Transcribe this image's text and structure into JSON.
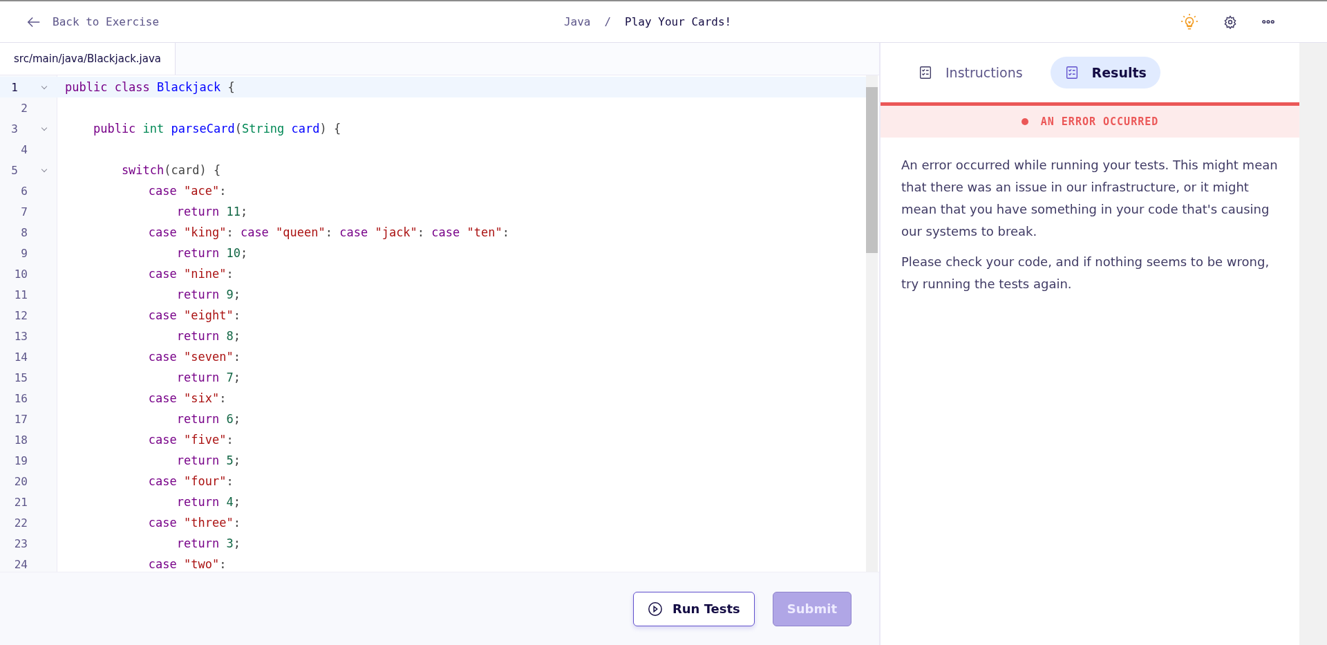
{
  "header": {
    "back_link": "Back to Exercise",
    "breadcrumb": {
      "track": "Java",
      "separator": "/",
      "exercise": "Play Your Cards!"
    }
  },
  "editor": {
    "tabs": [
      {
        "label": "src/main/java/Blackjack.java",
        "selected": true
      }
    ],
    "lines": [
      {
        "number": "1",
        "foldable": true,
        "active": true,
        "tokens": [
          {
            "kind": "keyword",
            "text": "public class "
          },
          {
            "kind": "def",
            "text": "Blackjack"
          },
          {
            "kind": "plain",
            "text": " {"
          }
        ]
      },
      {
        "number": "2",
        "foldable": false,
        "active": false
      },
      {
        "number": "3",
        "foldable": true,
        "active": false,
        "tokens": [
          {
            "kind": "keyword",
            "text": "    public "
          },
          {
            "kind": "type",
            "text": "int "
          },
          {
            "kind": "def",
            "text": "parseCard"
          },
          {
            "kind": "plain",
            "text": "("
          },
          {
            "kind": "type",
            "text": "String "
          },
          {
            "kind": "def",
            "text": "card"
          },
          {
            "kind": "plain",
            "text": ") {"
          }
        ]
      },
      {
        "number": "4",
        "foldable": false,
        "active": false
      },
      {
        "number": "5",
        "foldable": true,
        "active": false,
        "tokens": [
          {
            "kind": "keyword",
            "text": "        switch"
          },
          {
            "kind": "plain",
            "text": "(card) {"
          }
        ]
      },
      {
        "number": "6",
        "foldable": false,
        "active": false,
        "tokens": [
          {
            "kind": "keyword",
            "text": "            case "
          },
          {
            "kind": "string",
            "text": "\"ace\""
          },
          {
            "kind": "plain",
            "text": ":"
          }
        ]
      },
      {
        "number": "7",
        "foldable": false,
        "active": false,
        "tokens": [
          {
            "kind": "keyword",
            "text": "                return "
          },
          {
            "kind": "number",
            "text": "11"
          },
          {
            "kind": "plain",
            "text": ";"
          }
        ]
      },
      {
        "number": "8",
        "foldable": false,
        "active": false,
        "tokens": [
          {
            "kind": "keyword",
            "text": "            case "
          },
          {
            "kind": "string",
            "text": "\"king\""
          },
          {
            "kind": "plain",
            "text": ": "
          },
          {
            "kind": "keyword",
            "text": "case "
          },
          {
            "kind": "string",
            "text": "\"queen\""
          },
          {
            "kind": "plain",
            "text": ": "
          },
          {
            "kind": "keyword",
            "text": "case "
          },
          {
            "kind": "string",
            "text": "\"jack\""
          },
          {
            "kind": "plain",
            "text": ": "
          },
          {
            "kind": "keyword",
            "text": "case "
          },
          {
            "kind": "string",
            "text": "\"ten\""
          },
          {
            "kind": "plain",
            "text": ":"
          }
        ]
      },
      {
        "number": "9",
        "foldable": false,
        "active": false,
        "tokens": [
          {
            "kind": "keyword",
            "text": "                return "
          },
          {
            "kind": "number",
            "text": "10"
          },
          {
            "kind": "plain",
            "text": ";"
          }
        ]
      },
      {
        "number": "10",
        "foldable": false,
        "active": false,
        "tokens": [
          {
            "kind": "keyword",
            "text": "            case "
          },
          {
            "kind": "string",
            "text": "\"nine\""
          },
          {
            "kind": "plain",
            "text": ":"
          }
        ]
      },
      {
        "number": "11",
        "foldable": false,
        "active": false,
        "tokens": [
          {
            "kind": "keyword",
            "text": "                return "
          },
          {
            "kind": "number",
            "text": "9"
          },
          {
            "kind": "plain",
            "text": ";"
          }
        ]
      },
      {
        "number": "12",
        "foldable": false,
        "active": false,
        "tokens": [
          {
            "kind": "keyword",
            "text": "            case "
          },
          {
            "kind": "string",
            "text": "\"eight\""
          },
          {
            "kind": "plain",
            "text": ":"
          }
        ]
      },
      {
        "number": "13",
        "foldable": false,
        "active": false,
        "tokens": [
          {
            "kind": "keyword",
            "text": "                return "
          },
          {
            "kind": "number",
            "text": "8"
          },
          {
            "kind": "plain",
            "text": ";"
          }
        ]
      },
      {
        "number": "14",
        "foldable": false,
        "active": false,
        "tokens": [
          {
            "kind": "keyword",
            "text": "            case "
          },
          {
            "kind": "string",
            "text": "\"seven\""
          },
          {
            "kind": "plain",
            "text": ":"
          }
        ]
      },
      {
        "number": "15",
        "foldable": false,
        "active": false,
        "tokens": [
          {
            "kind": "keyword",
            "text": "                return "
          },
          {
            "kind": "number",
            "text": "7"
          },
          {
            "kind": "plain",
            "text": ";"
          }
        ]
      },
      {
        "number": "16",
        "foldable": false,
        "active": false,
        "tokens": [
          {
            "kind": "keyword",
            "text": "            case "
          },
          {
            "kind": "string",
            "text": "\"six\""
          },
          {
            "kind": "plain",
            "text": ":"
          }
        ]
      },
      {
        "number": "17",
        "foldable": false,
        "active": false,
        "tokens": [
          {
            "kind": "keyword",
            "text": "                return "
          },
          {
            "kind": "number",
            "text": "6"
          },
          {
            "kind": "plain",
            "text": ";"
          }
        ]
      },
      {
        "number": "18",
        "foldable": false,
        "active": false,
        "tokens": [
          {
            "kind": "keyword",
            "text": "            case "
          },
          {
            "kind": "string",
            "text": "\"five\""
          },
          {
            "kind": "plain",
            "text": ":"
          }
        ]
      },
      {
        "number": "19",
        "foldable": false,
        "active": false,
        "tokens": [
          {
            "kind": "keyword",
            "text": "                return "
          },
          {
            "kind": "number",
            "text": "5"
          },
          {
            "kind": "plain",
            "text": ";"
          }
        ]
      },
      {
        "number": "20",
        "foldable": false,
        "active": false,
        "tokens": [
          {
            "kind": "keyword",
            "text": "            case "
          },
          {
            "kind": "string",
            "text": "\"four\""
          },
          {
            "kind": "plain",
            "text": ":"
          }
        ]
      },
      {
        "number": "21",
        "foldable": false,
        "active": false,
        "tokens": [
          {
            "kind": "keyword",
            "text": "                return "
          },
          {
            "kind": "number",
            "text": "4"
          },
          {
            "kind": "plain",
            "text": ";"
          }
        ]
      },
      {
        "number": "22",
        "foldable": false,
        "active": false,
        "tokens": [
          {
            "kind": "keyword",
            "text": "            case "
          },
          {
            "kind": "string",
            "text": "\"three\""
          },
          {
            "kind": "plain",
            "text": ":"
          }
        ]
      },
      {
        "number": "23",
        "foldable": false,
        "active": false,
        "tokens": [
          {
            "kind": "keyword",
            "text": "                return "
          },
          {
            "kind": "number",
            "text": "3"
          },
          {
            "kind": "plain",
            "text": ";"
          }
        ]
      },
      {
        "number": "24",
        "foldable": false,
        "active": false,
        "tokens": [
          {
            "kind": "keyword",
            "text": "            case "
          },
          {
            "kind": "string",
            "text": "\"two\""
          },
          {
            "kind": "plain",
            "text": ":"
          }
        ]
      }
    ],
    "buttons": [
      {
        "label": "Run Tests",
        "kind": "run",
        "disabled": false
      },
      {
        "label": "Submit",
        "kind": "submit",
        "disabled": true
      }
    ]
  },
  "panel": {
    "tabs": [
      {
        "label": "Instructions",
        "selected": false
      },
      {
        "label": "Results",
        "selected": true
      }
    ],
    "status": {
      "label": "AN ERROR OCCURRED",
      "color": "#eb5757"
    },
    "paragraphs": [
      "An error occurred while running your tests. This might mean that there was an issue in our infrastructure, or it might mean that you have something in your code that's causing our systems to break.",
      "Please check your code, and if nothing seems to be wrong, try running the tests again."
    ]
  }
}
